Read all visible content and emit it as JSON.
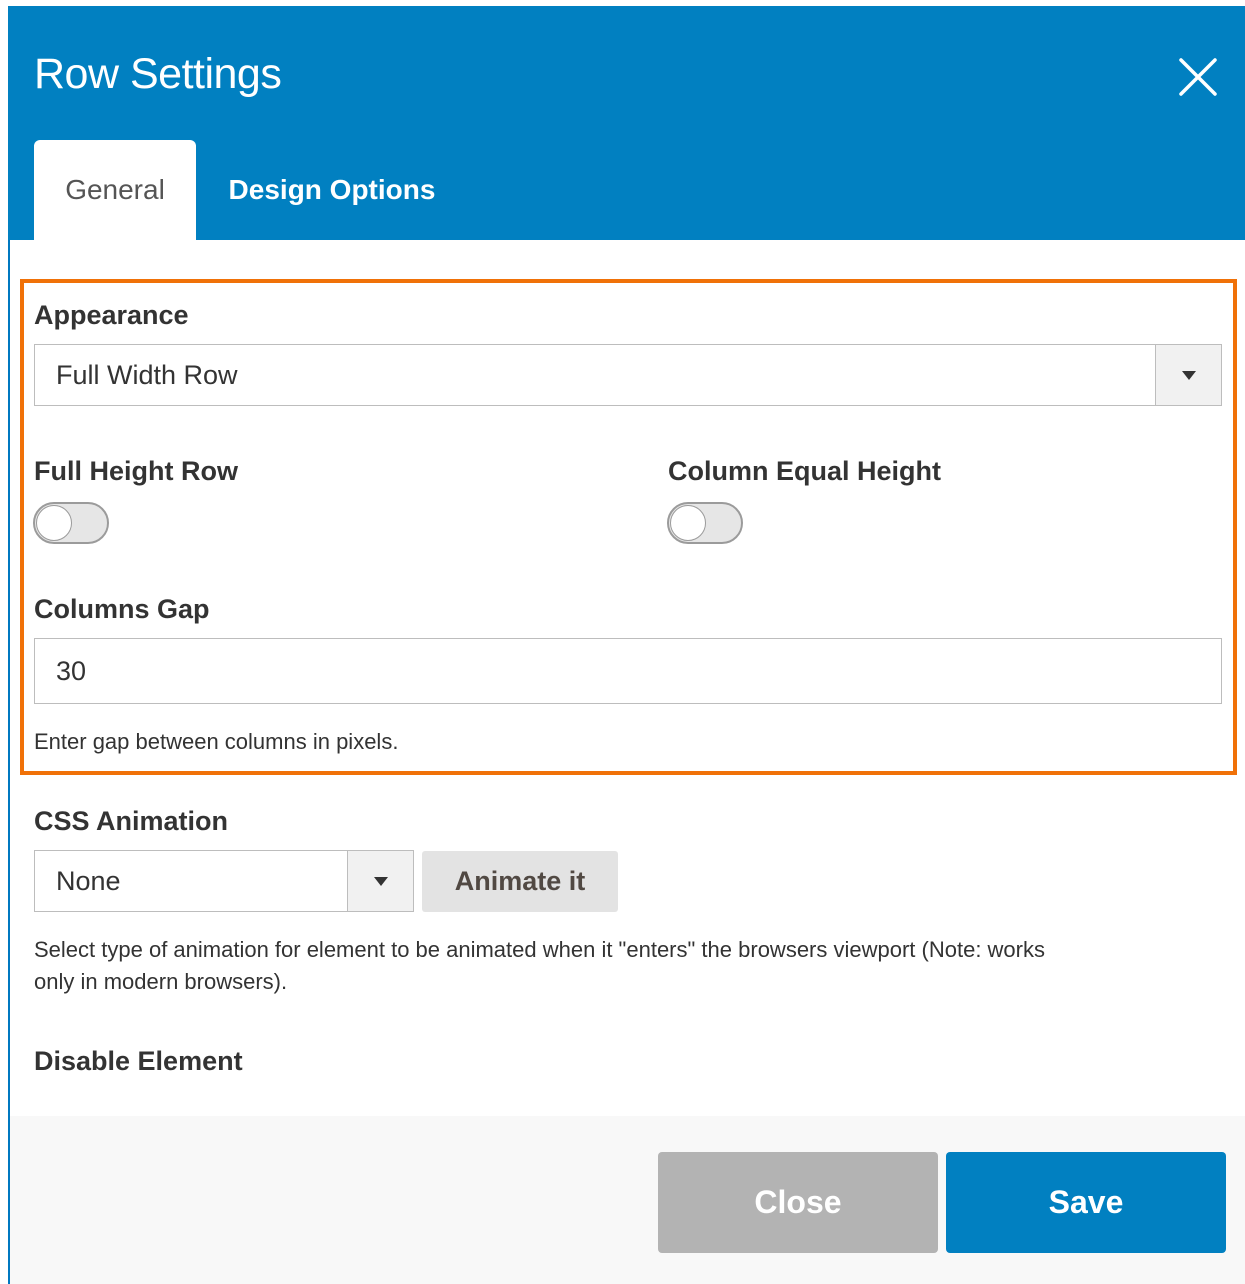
{
  "header": {
    "title": "Row Settings",
    "close_icon": "close-icon",
    "background": "#0180c1"
  },
  "tabs": [
    {
      "label": "General",
      "active": true
    },
    {
      "label": "Design Options",
      "active": false
    }
  ],
  "general": {
    "appearance": {
      "label": "Appearance",
      "value": "Full Width Row"
    },
    "full_height_row": {
      "label": "Full Height Row",
      "enabled": false
    },
    "column_equal_height": {
      "label": "Column Equal Height",
      "enabled": false
    },
    "columns_gap": {
      "label": "Columns Gap",
      "value": "30",
      "help": "Enter gap between columns in pixels."
    },
    "css_animation": {
      "label": "CSS Animation",
      "value": "None",
      "button": "Animate it",
      "help_line1": "Select type of animation for element to be animated when it \"enters\" the browsers viewport (Note: works",
      "help_line2": "only in modern browsers)."
    },
    "disable_element": {
      "label": "Disable Element"
    }
  },
  "footer": {
    "close_label": "Close",
    "save_label": "Save"
  },
  "colors": {
    "accent": "#0180c1",
    "highlight_border": "#f07108",
    "close_button": "#b3b3b3"
  }
}
